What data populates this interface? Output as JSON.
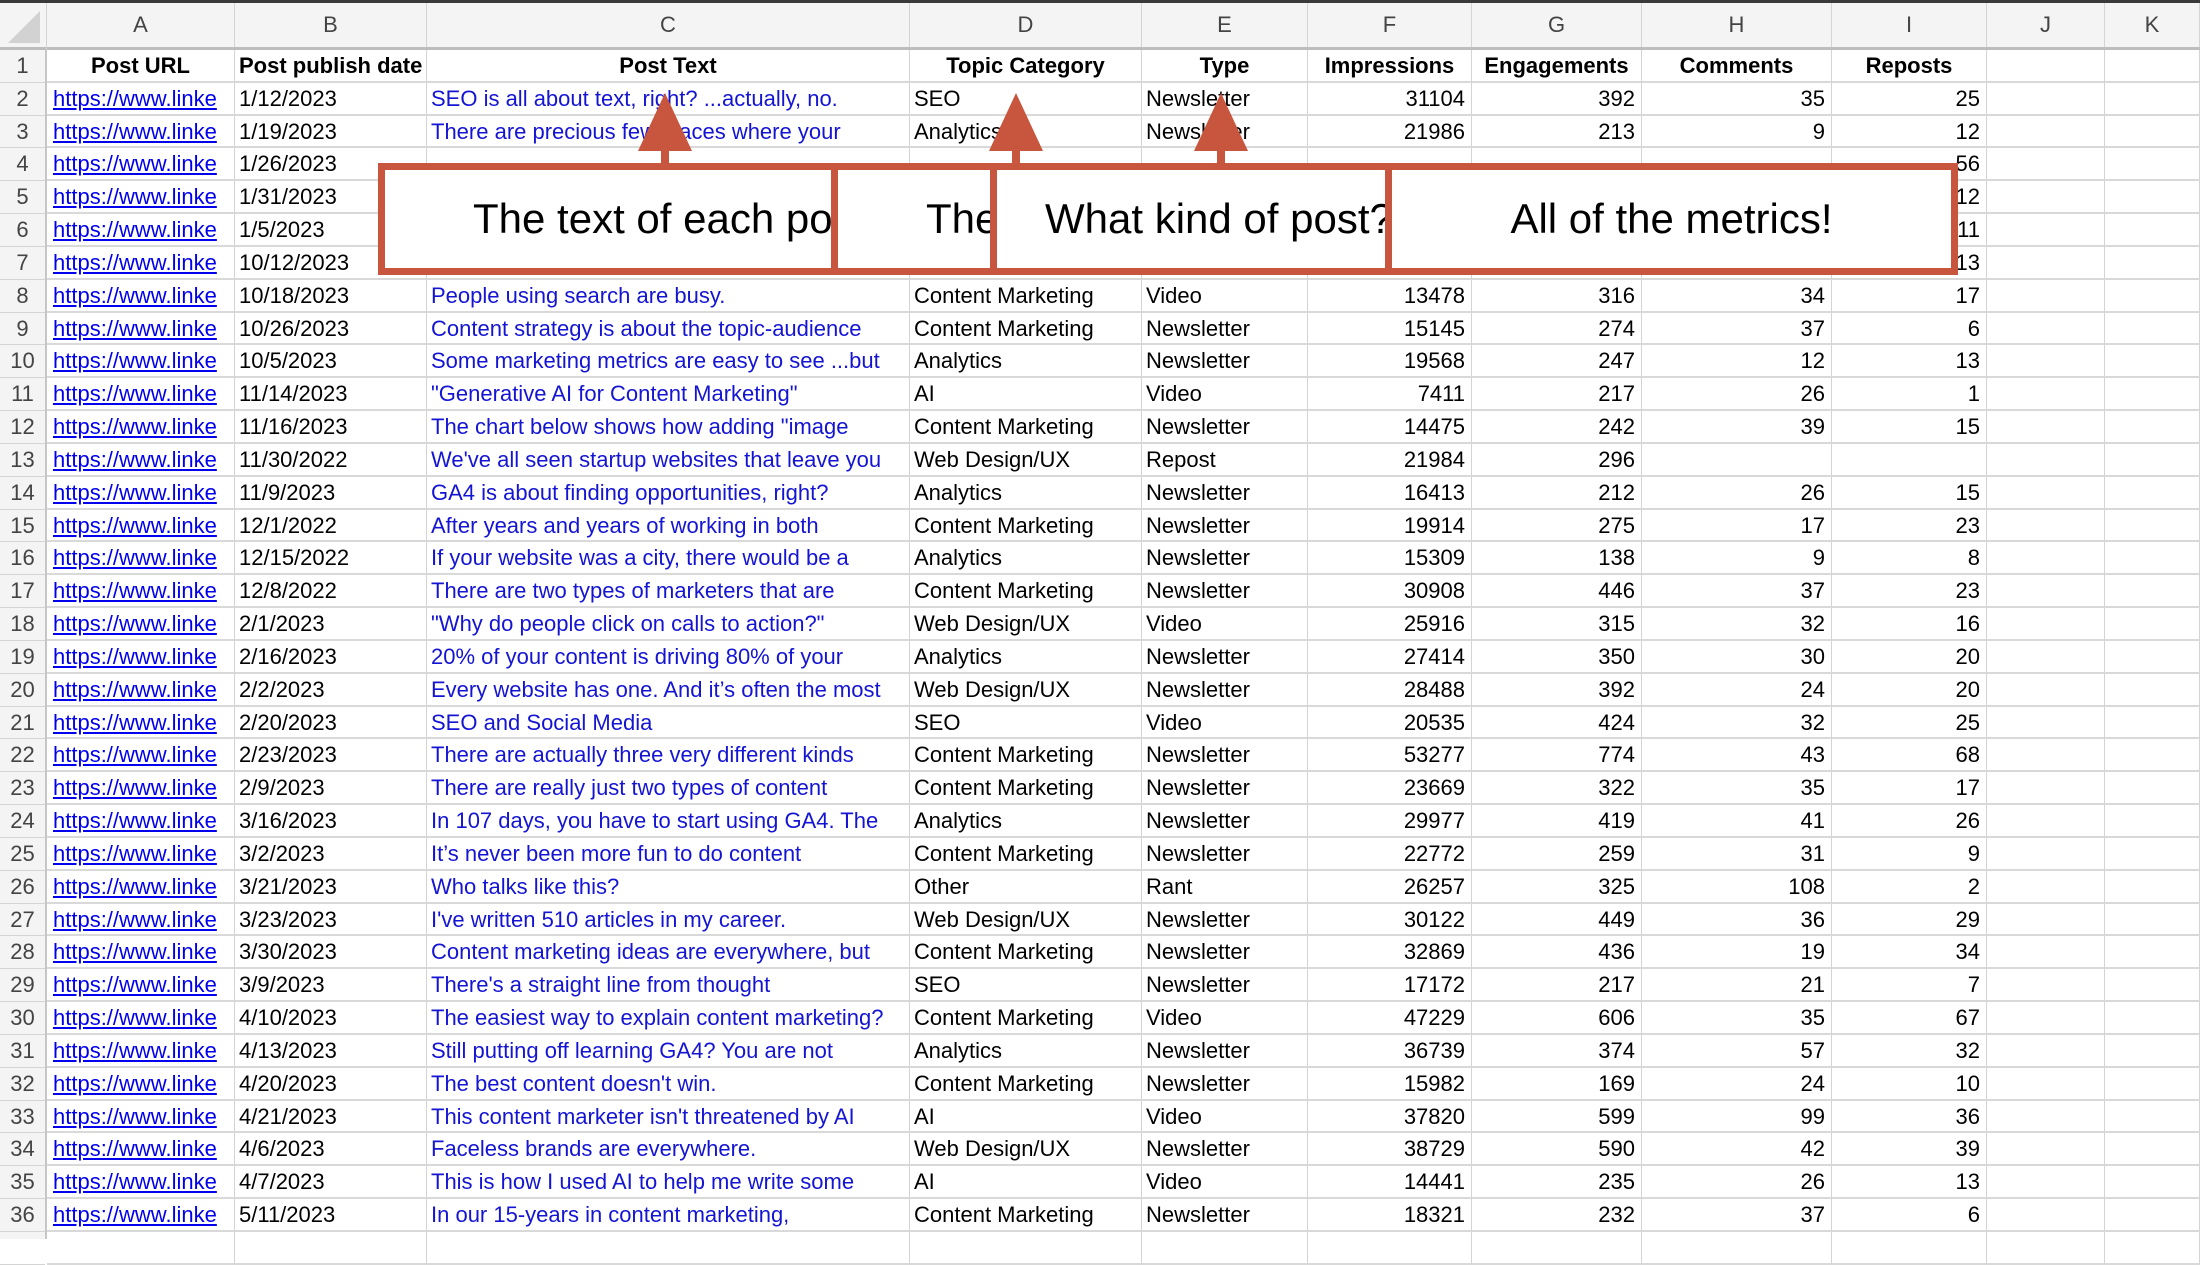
{
  "columns": [
    "A",
    "B",
    "C",
    "D",
    "E",
    "F",
    "G",
    "H",
    "I",
    "J",
    "K"
  ],
  "headers": [
    "Post URL",
    "Post publish date",
    "Post Text",
    "Topic Category",
    "Type",
    "Impressions",
    "Engagements",
    "Comments",
    "Reposts",
    "",
    ""
  ],
  "rows": [
    {
      "n": "2",
      "url": "https://www.linke",
      "date": "1/12/2023",
      "text": "SEO is all about text, right? ...actually, no.",
      "topic": "SEO",
      "type": "Newsletter",
      "imp": "31104",
      "eng": "392",
      "com": "35",
      "rep": "25"
    },
    {
      "n": "3",
      "url": "https://www.linke",
      "date": "1/19/2023",
      "text": "There are precious few places where your",
      "topic": "Analytics",
      "type": "Newsletter",
      "imp": "21986",
      "eng": "213",
      "com": "9",
      "rep": "12"
    },
    {
      "n": "4",
      "url": "https://www.linke",
      "date": "1/26/2023",
      "text": "",
      "topic": "",
      "type": "",
      "imp": "",
      "eng": "",
      "com": "",
      "rep": "56"
    },
    {
      "n": "5",
      "url": "https://www.linke",
      "date": "1/31/2023",
      "text": "",
      "topic": "",
      "type": "",
      "imp": "",
      "eng": "",
      "com": "",
      "rep": "12"
    },
    {
      "n": "6",
      "url": "https://www.linke",
      "date": "1/5/2023",
      "text": "",
      "topic": "",
      "type": "",
      "imp": "",
      "eng": "",
      "com": "",
      "rep": "11"
    },
    {
      "n": "7",
      "url": "https://www.linke",
      "date": "10/12/2023",
      "text": "",
      "topic": "",
      "type": "",
      "imp": "",
      "eng": "",
      "com": "",
      "rep": "13"
    },
    {
      "n": "8",
      "url": "https://www.linke",
      "date": "10/18/2023",
      "text": "People using search are busy.",
      "topic": "Content Marketing",
      "type": "Video",
      "imp": "13478",
      "eng": "316",
      "com": "34",
      "rep": "17"
    },
    {
      "n": "9",
      "url": "https://www.linke",
      "date": "10/26/2023",
      "text": "Content strategy is about the topic-audience",
      "topic": "Content Marketing",
      "type": "Newsletter",
      "imp": "15145",
      "eng": "274",
      "com": "37",
      "rep": "6"
    },
    {
      "n": "10",
      "url": "https://www.linke",
      "date": "10/5/2023",
      "text": "Some marketing metrics are easy to see ...but",
      "topic": "Analytics",
      "type": "Newsletter",
      "imp": "19568",
      "eng": "247",
      "com": "12",
      "rep": "13"
    },
    {
      "n": "11",
      "url": "https://www.linke",
      "date": "11/14/2023",
      "text": "\"Generative AI for Content Marketing\"",
      "topic": "AI",
      "type": "Video",
      "imp": "7411",
      "eng": "217",
      "com": "26",
      "rep": "1"
    },
    {
      "n": "12",
      "url": "https://www.linke",
      "date": "11/16/2023",
      "text": "The chart below shows how adding \"image",
      "topic": "Content Marketing",
      "type": "Newsletter",
      "imp": "14475",
      "eng": "242",
      "com": "39",
      "rep": "15"
    },
    {
      "n": "13",
      "url": "https://www.linke",
      "date": "11/30/2022",
      "text": "We've all seen startup websites that leave you",
      "topic": "Web Design/UX",
      "type": "Repost",
      "imp": "21984",
      "eng": "296",
      "com": "",
      "rep": ""
    },
    {
      "n": "14",
      "url": "https://www.linke",
      "date": "11/9/2023",
      "text": "GA4 is about finding opportunities, right?",
      "topic": "Analytics",
      "type": "Newsletter",
      "imp": "16413",
      "eng": "212",
      "com": "26",
      "rep": "15"
    },
    {
      "n": "15",
      "url": "https://www.linke",
      "date": "12/1/2022",
      "text": "After years and years of working in both",
      "topic": "Content Marketing",
      "type": "Newsletter",
      "imp": "19914",
      "eng": "275",
      "com": "17",
      "rep": "23"
    },
    {
      "n": "16",
      "url": "https://www.linke",
      "date": "12/15/2022",
      "text": "If your website was a city, there would be a",
      "topic": "Analytics",
      "type": "Newsletter",
      "imp": "15309",
      "eng": "138",
      "com": "9",
      "rep": "8"
    },
    {
      "n": "17",
      "url": "https://www.linke",
      "date": "12/8/2022",
      "text": "There are two types of marketers that are",
      "topic": "Content Marketing",
      "type": "Newsletter",
      "imp": "30908",
      "eng": "446",
      "com": "37",
      "rep": "23"
    },
    {
      "n": "18",
      "url": "https://www.linke",
      "date": "2/1/2023",
      "text": "\"Why do people click on calls to action?\"",
      "topic": "Web Design/UX",
      "type": "Video",
      "imp": "25916",
      "eng": "315",
      "com": "32",
      "rep": "16"
    },
    {
      "n": "19",
      "url": "https://www.linke",
      "date": "2/16/2023",
      "text": "20% of your content is driving 80% of your",
      "topic": "Analytics",
      "type": "Newsletter",
      "imp": "27414",
      "eng": "350",
      "com": "30",
      "rep": "20"
    },
    {
      "n": "20",
      "url": "https://www.linke",
      "date": "2/2/2023",
      "text": "Every website has one. And it’s often the most",
      "topic": "Web Design/UX",
      "type": "Newsletter",
      "imp": "28488",
      "eng": "392",
      "com": "24",
      "rep": "20"
    },
    {
      "n": "21",
      "url": "https://www.linke",
      "date": "2/20/2023",
      "text": "SEO and Social Media",
      "topic": "SEO",
      "type": "Video",
      "imp": "20535",
      "eng": "424",
      "com": "32",
      "rep": "25"
    },
    {
      "n": "22",
      "url": "https://www.linke",
      "date": "2/23/2023",
      "text": "There are actually three very different kinds",
      "topic": "Content Marketing",
      "type": "Newsletter",
      "imp": "53277",
      "eng": "774",
      "com": "43",
      "rep": "68"
    },
    {
      "n": "23",
      "url": "https://www.linke",
      "date": "2/9/2023",
      "text": "There are really just two types of content",
      "topic": "Content Marketing",
      "type": "Newsletter",
      "imp": "23669",
      "eng": "322",
      "com": "35",
      "rep": "17"
    },
    {
      "n": "24",
      "url": "https://www.linke",
      "date": "3/16/2023",
      "text": "In 107 days, you have to start using GA4. The",
      "topic": "Analytics",
      "type": "Newsletter",
      "imp": "29977",
      "eng": "419",
      "com": "41",
      "rep": "26"
    },
    {
      "n": "25",
      "url": "https://www.linke",
      "date": "3/2/2023",
      "text": "It’s never been more fun to do content",
      "topic": "Content Marketing",
      "type": "Newsletter",
      "imp": "22772",
      "eng": "259",
      "com": "31",
      "rep": "9"
    },
    {
      "n": "26",
      "url": "https://www.linke",
      "date": "3/21/2023",
      "text": "Who talks like this?",
      "topic": "Other",
      "type": "Rant",
      "imp": "26257",
      "eng": "325",
      "com": "108",
      "rep": "2"
    },
    {
      "n": "27",
      "url": "https://www.linke",
      "date": "3/23/2023",
      "text": "I've written 510 articles in my career.",
      "topic": "Web Design/UX",
      "type": "Newsletter",
      "imp": "30122",
      "eng": "449",
      "com": "36",
      "rep": "29"
    },
    {
      "n": "28",
      "url": "https://www.linke",
      "date": "3/30/2023",
      "text": "Content marketing ideas are everywhere, but",
      "topic": "Content Marketing",
      "type": "Newsletter",
      "imp": "32869",
      "eng": "436",
      "com": "19",
      "rep": "34"
    },
    {
      "n": "29",
      "url": "https://www.linke",
      "date": "3/9/2023",
      "text": "There's a straight line from thought",
      "topic": "SEO",
      "type": "Newsletter",
      "imp": "17172",
      "eng": "217",
      "com": "21",
      "rep": "7"
    },
    {
      "n": "30",
      "url": "https://www.linke",
      "date": "4/10/2023",
      "text": "The easiest way to explain content marketing?",
      "topic": "Content Marketing",
      "type": "Video",
      "imp": "47229",
      "eng": "606",
      "com": "35",
      "rep": "67"
    },
    {
      "n": "31",
      "url": "https://www.linke",
      "date": "4/13/2023",
      "text": "Still putting off learning GA4? You are not",
      "topic": "Analytics",
      "type": "Newsletter",
      "imp": "36739",
      "eng": "374",
      "com": "57",
      "rep": "32"
    },
    {
      "n": "32",
      "url": "https://www.linke",
      "date": "4/20/2023",
      "text": "The best content doesn't win.",
      "topic": "Content Marketing",
      "type": "Newsletter",
      "imp": "15982",
      "eng": "169",
      "com": "24",
      "rep": "10"
    },
    {
      "n": "33",
      "url": "https://www.linke",
      "date": "4/21/2023",
      "text": "This content marketer isn't threatened by AI",
      "topic": "AI",
      "type": "Video",
      "imp": "37820",
      "eng": "599",
      "com": "99",
      "rep": "36"
    },
    {
      "n": "34",
      "url": "https://www.linke",
      "date": "4/6/2023",
      "text": "Faceless brands are everywhere.",
      "topic": "Web Design/UX",
      "type": "Newsletter",
      "imp": "38729",
      "eng": "590",
      "com": "42",
      "rep": "39"
    },
    {
      "n": "35",
      "url": "https://www.linke",
      "date": "4/7/2023",
      "text": "This is how I used AI to help me write some",
      "topic": "AI",
      "type": "Video",
      "imp": "14441",
      "eng": "235",
      "com": "26",
      "rep": "13"
    },
    {
      "n": "36",
      "url": "https://www.linke",
      "date": "5/11/2023",
      "text": "In our 15-years in content marketing,",
      "topic": "Content Marketing",
      "type": "Newsletter",
      "imp": "18321",
      "eng": "232",
      "com": "37",
      "rep": "6"
    }
  ],
  "callouts": [
    {
      "text": "The text of each post"
    },
    {
      "text": "The topic"
    },
    {
      "text": "What kind of post?"
    },
    {
      "text": "All of the metrics!"
    }
  ],
  "colors": {
    "callout_border": "#c8553d",
    "link": "#0000ee",
    "post_text": "#1414d4"
  }
}
